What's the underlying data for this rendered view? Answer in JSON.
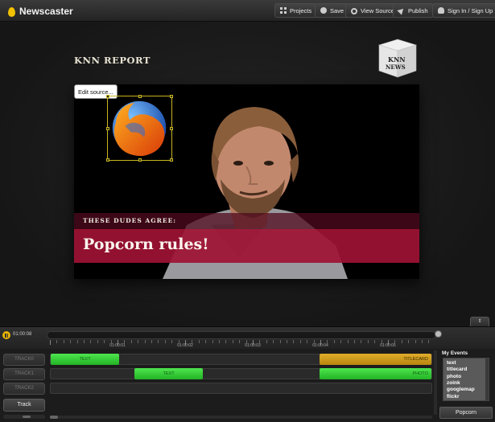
{
  "app": {
    "name": "Newscaster"
  },
  "toolbar": {
    "projects": "Projects",
    "save": "Save",
    "view_source": "View Source",
    "publish": "Publish",
    "signin": "Sign In / Sign Up"
  },
  "stage": {
    "title": "KNN REPORT",
    "logo_text": [
      "KNN",
      "NEWS"
    ],
    "edit_source": "Edit source...",
    "lower_third_tag": "THESE DUDES AGREE:",
    "lower_third_main": "Popcorn rules!"
  },
  "timeline": {
    "current_time": "01:00:08",
    "markers": [
      "01:00:01",
      "01:00:02",
      "01:00:03",
      "01:00:04",
      "01:00:05"
    ],
    "collapse_label": "⇕",
    "tracks": [
      {
        "label": "TRACK0",
        "events": [
          {
            "label": "TEXT",
            "type": "green",
            "start": 0.0,
            "end": 0.18
          },
          {
            "label": "TITLECARD",
            "type": "gold",
            "start": 0.707,
            "end": 1.0
          }
        ]
      },
      {
        "label": "TRACK1",
        "events": [
          {
            "label": "TEXT",
            "type": "green",
            "start": 0.22,
            "end": 0.4
          },
          {
            "label": "PHOTO",
            "type": "green-right",
            "start": 0.707,
            "end": 1.0
          }
        ]
      },
      {
        "label": "TRACK2",
        "events": []
      }
    ],
    "add_track_label": "Track"
  },
  "events_panel": {
    "title": "My Events",
    "items": [
      "text",
      "titlecard",
      "photo",
      "zoink",
      "googlemap",
      "flickr"
    ]
  },
  "popcorn_button": "Popcorn",
  "colors": {
    "accent": "#e8b300",
    "lower_third": "#a01234",
    "event_green": "#35c836",
    "event_gold": "#d19b1c"
  }
}
